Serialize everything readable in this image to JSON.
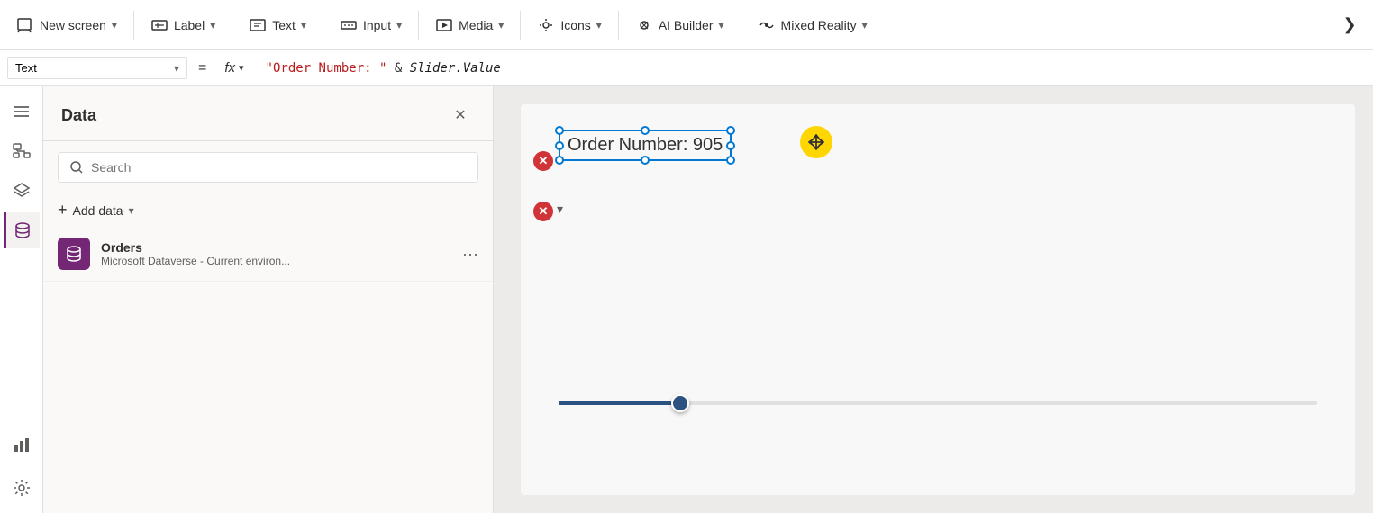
{
  "toolbar": {
    "new_screen_label": "New screen",
    "new_screen_chevron": "▾",
    "label_label": "Label",
    "label_chevron": "▾",
    "text_label": "Text",
    "text_chevron": "▾",
    "input_label": "Input",
    "input_chevron": "▾",
    "media_label": "Media",
    "media_chevron": "▾",
    "icons_label": "Icons",
    "icons_chevron": "▾",
    "ai_builder_label": "AI Builder",
    "ai_builder_chevron": "▾",
    "mixed_reality_label": "Mixed Reality",
    "mixed_reality_chevron": "▾",
    "expand_icon": "❯"
  },
  "formula_bar": {
    "property_label": "Text",
    "property_chevron": "▾",
    "equals": "=",
    "fx_label": "fx",
    "fx_chevron": "▾",
    "formula_string": "\"Order Number: \"",
    "formula_operator": " & ",
    "formula_code": "Slider.Value"
  },
  "sidebar": {
    "menu_icon": "☰",
    "tree_icon": "⊞",
    "data_icon": "⊞",
    "active_icon": "🗄",
    "chart_icon": "📊",
    "settings_icon": "⚙"
  },
  "data_panel": {
    "title": "Data",
    "close_icon": "✕",
    "search_placeholder": "Search",
    "search_icon": "🔍",
    "add_data_plus": "+",
    "add_data_label": "Add data",
    "add_data_chevron": "▾",
    "datasource": {
      "name": "Orders",
      "description": "Microsoft Dataverse - Current environ...",
      "menu_icon": "···"
    }
  },
  "canvas": {
    "text_content": "Order Number: 905",
    "slider_value": 905,
    "slider_min": 0,
    "slider_max": 1000,
    "move_icon": "✥"
  },
  "colors": {
    "accent_purple": "#742774",
    "active_border": "#0078d4",
    "slider_track": "#2c5282",
    "error_red": "#d13438",
    "move_yellow": "#ffd600"
  }
}
